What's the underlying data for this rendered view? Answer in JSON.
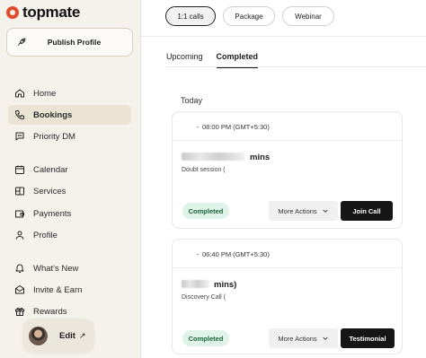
{
  "brand": {
    "name": "topmate",
    "color": "#e34a2e"
  },
  "sidebar": {
    "publish_label": "Publish Profile",
    "items": [
      {
        "label": "Home",
        "icon": "home-icon"
      },
      {
        "label": "Bookings",
        "icon": "phone-icon",
        "active": true
      },
      {
        "label": "Priority DM",
        "icon": "message-icon"
      },
      {
        "label": "Calendar",
        "icon": "calendar-icon"
      },
      {
        "label": "Services",
        "icon": "services-icon"
      },
      {
        "label": "Payments",
        "icon": "wallet-icon"
      },
      {
        "label": "Profile",
        "icon": "user-icon"
      },
      {
        "label": "What's New",
        "icon": "bell-icon"
      },
      {
        "label": "Invite & Earn",
        "icon": "mail-icon"
      },
      {
        "label": "Rewards",
        "icon": "gift-icon"
      }
    ],
    "edit_label": "Edit",
    "edit_arrow": "↗"
  },
  "header": {
    "tabs": [
      {
        "label": "1:1 calls",
        "active": true
      },
      {
        "label": "Package"
      },
      {
        "label": "Webinar"
      }
    ]
  },
  "subtabs": [
    {
      "label": "Upcoming"
    },
    {
      "label": "Completed",
      "active": true
    }
  ],
  "section_label": "Today",
  "bookings": [
    {
      "time": "08:00 PM (GMT+5:30)",
      "duration": "mins",
      "service": "Doubt session (",
      "status": "Completed",
      "more_actions": "More Actions",
      "primary_action": "Join Call"
    },
    {
      "time": "06:40 PM (GMT+5:30)",
      "duration": "mins)",
      "service": "Discovery Call (",
      "status": "Completed",
      "more_actions": "More Actions",
      "primary_action": "Testimonial"
    }
  ],
  "colors": {
    "status_bg": "#dff3e8",
    "status_text": "#17643a",
    "primary_btn": "#161616",
    "sidebar_bg": "#f5f2ec"
  }
}
